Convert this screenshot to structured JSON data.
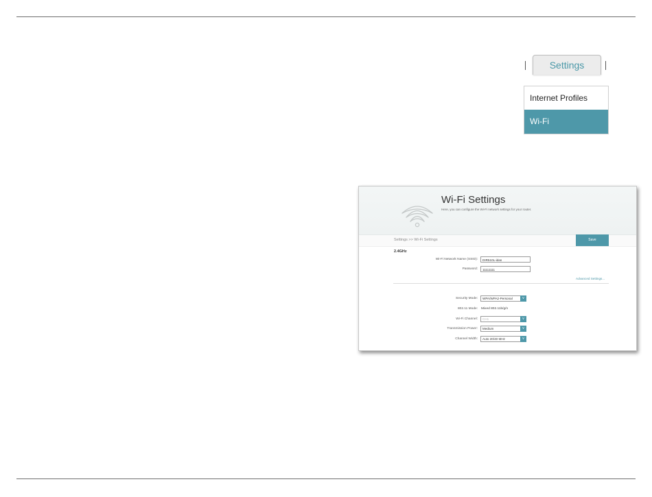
{
  "menu": {
    "tab_label": "Settings",
    "items": [
      {
        "label": "Internet Profiles",
        "active": false
      },
      {
        "label": "Wi-Fi",
        "active": true
      }
    ]
  },
  "wifi_settings": {
    "title": "Wi-Fi Settings",
    "description": "Here, you can configure the Wi-Fi network settings for your router.",
    "breadcrumb": "Settings >> Wi-Fi Settings",
    "save_label": "Save",
    "band_label": "2.4GHz",
    "ssid": {
      "label": "Wi-Fi Network Name (SSID):",
      "value": "DIR510L-idan"
    },
    "password": {
      "label": "Password:",
      "value": "11111111"
    },
    "advanced_link": "Advanced Settings...",
    "security_mode": {
      "label": "Security Mode:",
      "value": "WPA/WPA2-Personal"
    },
    "mode_80211": {
      "label": "802.11 Mode:",
      "value": "Mixed 802.11b/g/n"
    },
    "channel": {
      "label": "Wi-Fi Channel:",
      "value": "CH1"
    },
    "tx_power": {
      "label": "Transmission Power:",
      "value": "Medium"
    },
    "channel_width": {
      "label": "Channel Width:",
      "value": "Auto 20/40 MHz"
    }
  },
  "colors": {
    "accent": "#4e98a9",
    "tab_text": "#4a98a8",
    "rule": "#6e6e6e"
  },
  "icons": {
    "dropdown_arrow": "chevron-down-icon",
    "wifi": "wifi-icon"
  }
}
